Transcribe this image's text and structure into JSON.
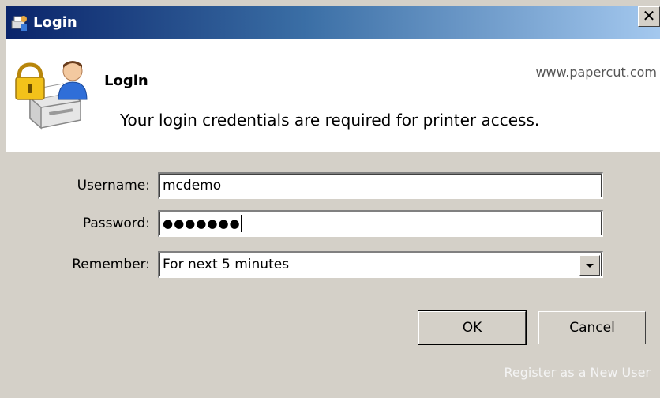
{
  "titlebar": {
    "title": "Login",
    "close_label": "✕",
    "icon": "papercut-app-icon"
  },
  "header": {
    "title": "Login",
    "url": "www.papercut.com",
    "description": "Your login credentials are required for printer access.",
    "icon": "printer-lock-user-icon"
  },
  "form": {
    "username_label": "Username:",
    "username_value": "mcdemo",
    "password_label": "Password:",
    "password_value": "●●●●●●●",
    "remember_label": "Remember:",
    "remember_value": "For next 5 minutes"
  },
  "buttons": {
    "ok_label": "OK",
    "cancel_label": "Cancel"
  },
  "footer": {
    "register_label": "Register as a New User"
  },
  "colors": {
    "titlebar_start": "#0a246a",
    "titlebar_end": "#a6caf0",
    "dialog_bg": "#d4d0c8"
  }
}
